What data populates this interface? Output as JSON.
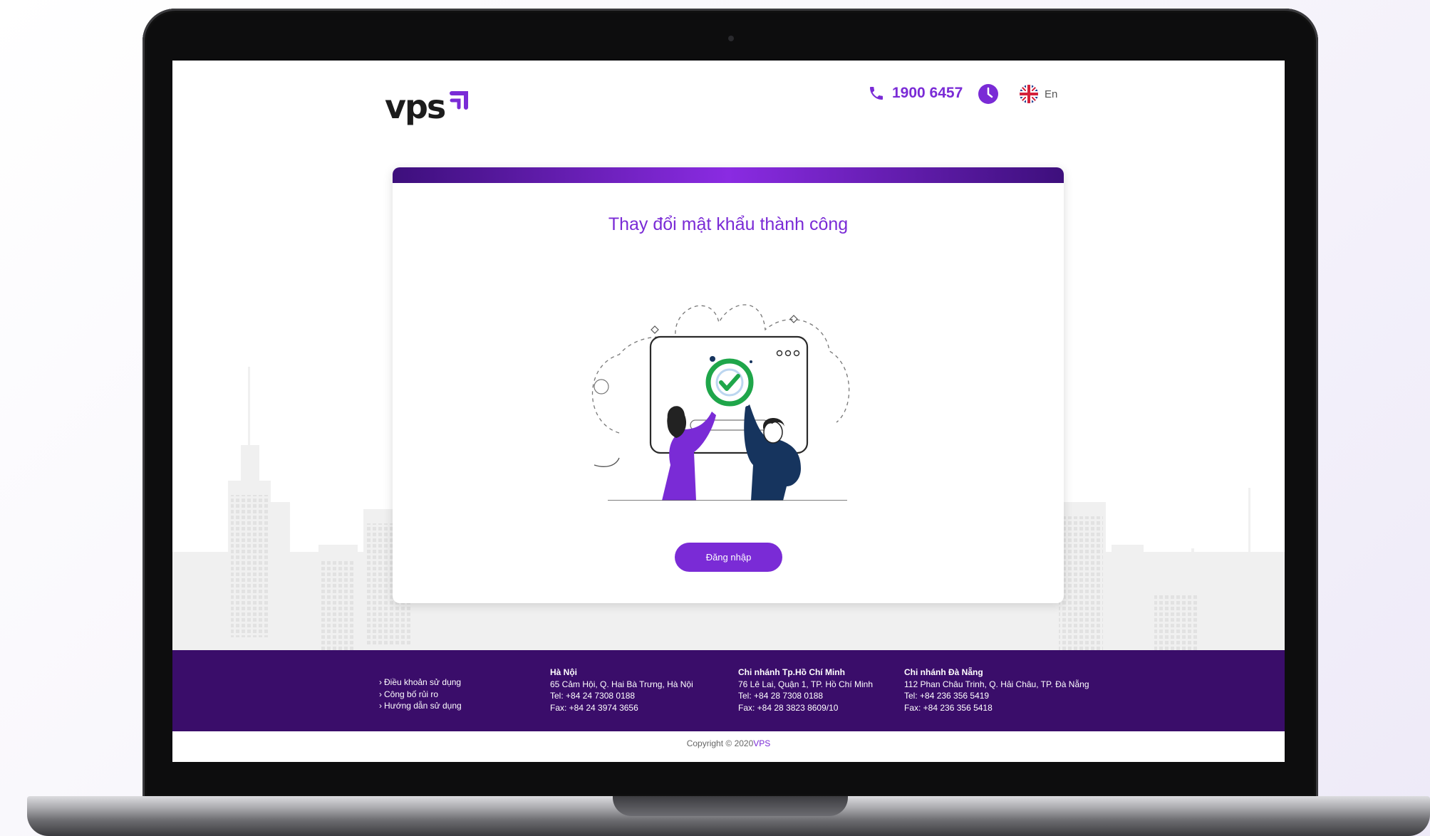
{
  "header": {
    "logo_text": "vps",
    "hotline": "1900 6457",
    "language": "En"
  },
  "card": {
    "title": "Thay đổi mật khẩu thành công",
    "login_button": "Đăng nhập"
  },
  "footer": {
    "links": [
      "Điều khoản sử dụng",
      "Công bố rủi ro",
      "Hướng dẫn sử dụng"
    ],
    "branches": [
      {
        "name": "Hà Nội",
        "address": "65 Cảm Hội, Q. Hai Bà Trưng, Hà Nội",
        "tel": "Tel: +84 24 7308 0188",
        "fax": "Fax: +84 24 3974 3656"
      },
      {
        "name": "Chi nhánh Tp.Hồ Chí Minh",
        "address": "76 Lê Lai, Quận 1, TP. Hồ Chí Minh",
        "tel": "Tel: +84 28 7308 0188",
        "fax": "Fax: +84 28 3823 8609/10"
      },
      {
        "name": "Chi nhánh Đà Nẵng",
        "address": "112 Phan Châu Trinh, Q. Hải Châu, TP. Đà Nẵng",
        "tel": "Tel: +84 236 356 5419",
        "fax": "Fax: +84 236 356 5418"
      }
    ]
  },
  "copyright": {
    "text": "Copyright © 2020",
    "brand": "VPS"
  },
  "colors": {
    "accent": "#7a2bd6",
    "footer_bg": "#3a0d6a",
    "success": "#1fa64a"
  },
  "icons": [
    "phone-icon",
    "clock-icon",
    "uk-flag-icon",
    "chevron-right-icon",
    "success-check-icon"
  ]
}
